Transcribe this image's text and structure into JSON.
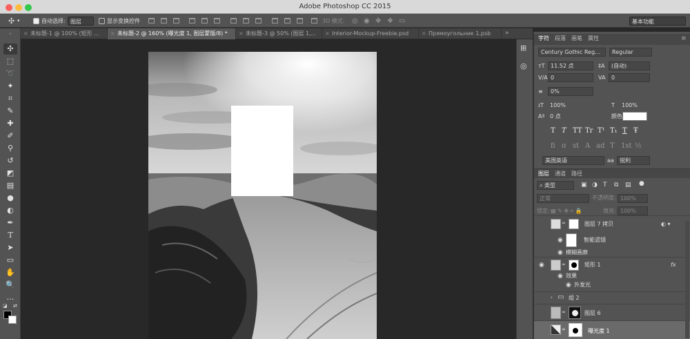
{
  "app": {
    "title": "Adobe Photoshop CC 2015"
  },
  "options": {
    "auto_select_label": "自动选择:",
    "auto_select_value": "图层",
    "transform_label": "显示变换控件",
    "mode3d": "3D 模式:",
    "workspace": "基本功能"
  },
  "tabs": [
    {
      "label": "未标题-1 @ 100% (矩形 ..."
    },
    {
      "label": "未标题-2 @ 160% (曝光度 1, 图层蒙版/8) *"
    },
    {
      "label": "未标题-3 @ 50% (图层 1,..."
    },
    {
      "label": "Interior-Mockup-Freebie.psd"
    },
    {
      "label": "Прямоугольник 1.psb"
    }
  ],
  "character": {
    "tabs": [
      "字符",
      "段落",
      "画笔",
      "属性"
    ],
    "font_family": "Century Gothic Reg...",
    "font_style": "Regular",
    "font_size": "11.52 点",
    "leading": "(自动)",
    "kerning": "0",
    "tracking": "0",
    "scale_pct": "0%",
    "vscale": "100%",
    "hscale": "100%",
    "baseline": "0 点",
    "color_label": "颜色:",
    "format_buttons": [
      "T",
      "T",
      "TT",
      "Tr",
      "T¹",
      "T₁",
      "T",
      "Ŧ"
    ],
    "ot_buttons": [
      "fi",
      "σ",
      "st",
      "A",
      "ad",
      "T",
      "1st",
      "½"
    ],
    "language": "美国英语",
    "aa_label": "aa",
    "aa_value": "锐利"
  },
  "layers": {
    "tabs": [
      "图层",
      "通道",
      "路径"
    ],
    "filter": "类型",
    "blend": "正常",
    "opacity_label": "不透明度:",
    "opacity": "100%",
    "lock_label": "锁定:",
    "fill_label": "填充:",
    "fill": "100%",
    "items": [
      {
        "name": "图层 7 拷贝"
      },
      {
        "name": "智能滤镜"
      },
      {
        "name": "模糊画廊"
      },
      {
        "name": "矩形 1",
        "fx": "fx"
      },
      {
        "name": "效果"
      },
      {
        "name": "外发光"
      },
      {
        "name": "组 2"
      },
      {
        "name": "图层 6"
      },
      {
        "name": "曝光度 1"
      }
    ]
  }
}
